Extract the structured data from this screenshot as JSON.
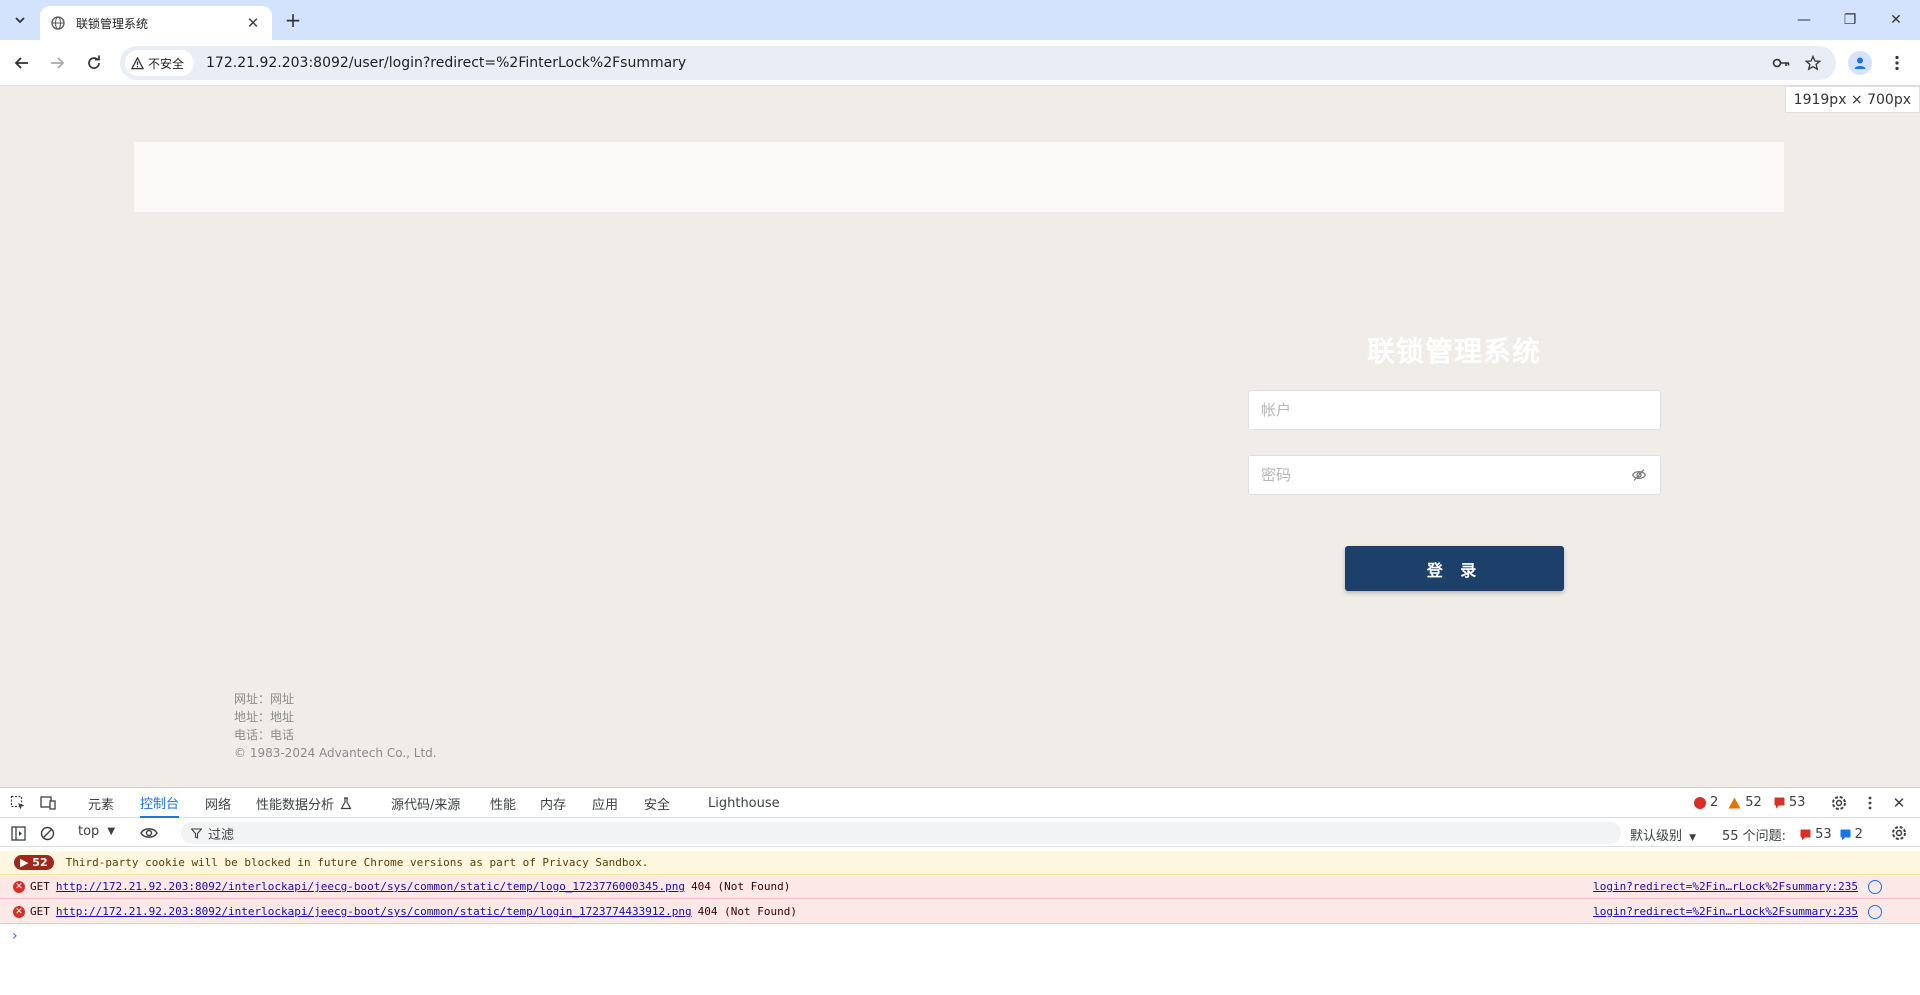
{
  "browser": {
    "tab_title": "联锁管理系统",
    "url": "172.21.92.203:8092/user/login?redirect=%2FinterLock%2Fsummary",
    "security_label": "不安全",
    "viewport_size": "1919px × 700px"
  },
  "login": {
    "title": "联锁管理系统",
    "username_placeholder": "帐户",
    "password_placeholder": "密码",
    "submit_label": "登 录",
    "button_color": "#1d406b"
  },
  "footer": {
    "website": "网址：网址",
    "address": "地址：地址",
    "phone": "电话：电话",
    "copyright": "© 1983-2024 Advantech Co., Ltd."
  },
  "devtools": {
    "tabs": [
      "元素",
      "控制台",
      "网络",
      "性能数据分析",
      "源代码/来源",
      "性能",
      "内存",
      "应用",
      "安全",
      "Lighthouse"
    ],
    "active_tab": "控制台",
    "counts": {
      "errors": "2",
      "warnings": "52",
      "issues": "53"
    },
    "context": "top",
    "filter_placeholder": "过滤",
    "level": "默认级别",
    "issues_label": "55 个问题:",
    "issues_red": "53",
    "issues_blue": "2",
    "messages": [
      {
        "type": "warn",
        "count": "52",
        "text": "Third-party cookie will be blocked in future Chrome versions as part of Privacy Sandbox."
      },
      {
        "type": "error",
        "method": "GET",
        "url": "http://172.21.92.203:8092/interlockapi/jeecg-boot/sys/common/static/temp/logo_1723776000345.png",
        "status": "404 (Not Found)",
        "source": "login?redirect=%2Fin…rLock%2Fsummary:235"
      },
      {
        "type": "error",
        "method": "GET",
        "url": "http://172.21.92.203:8092/interlockapi/jeecg-boot/sys/common/static/temp/login_1723774433912.png",
        "status": "404 (Not Found)",
        "source": "login?redirect=%2Fin…rLock%2Fsummary:235"
      }
    ],
    "prompt": "›"
  }
}
